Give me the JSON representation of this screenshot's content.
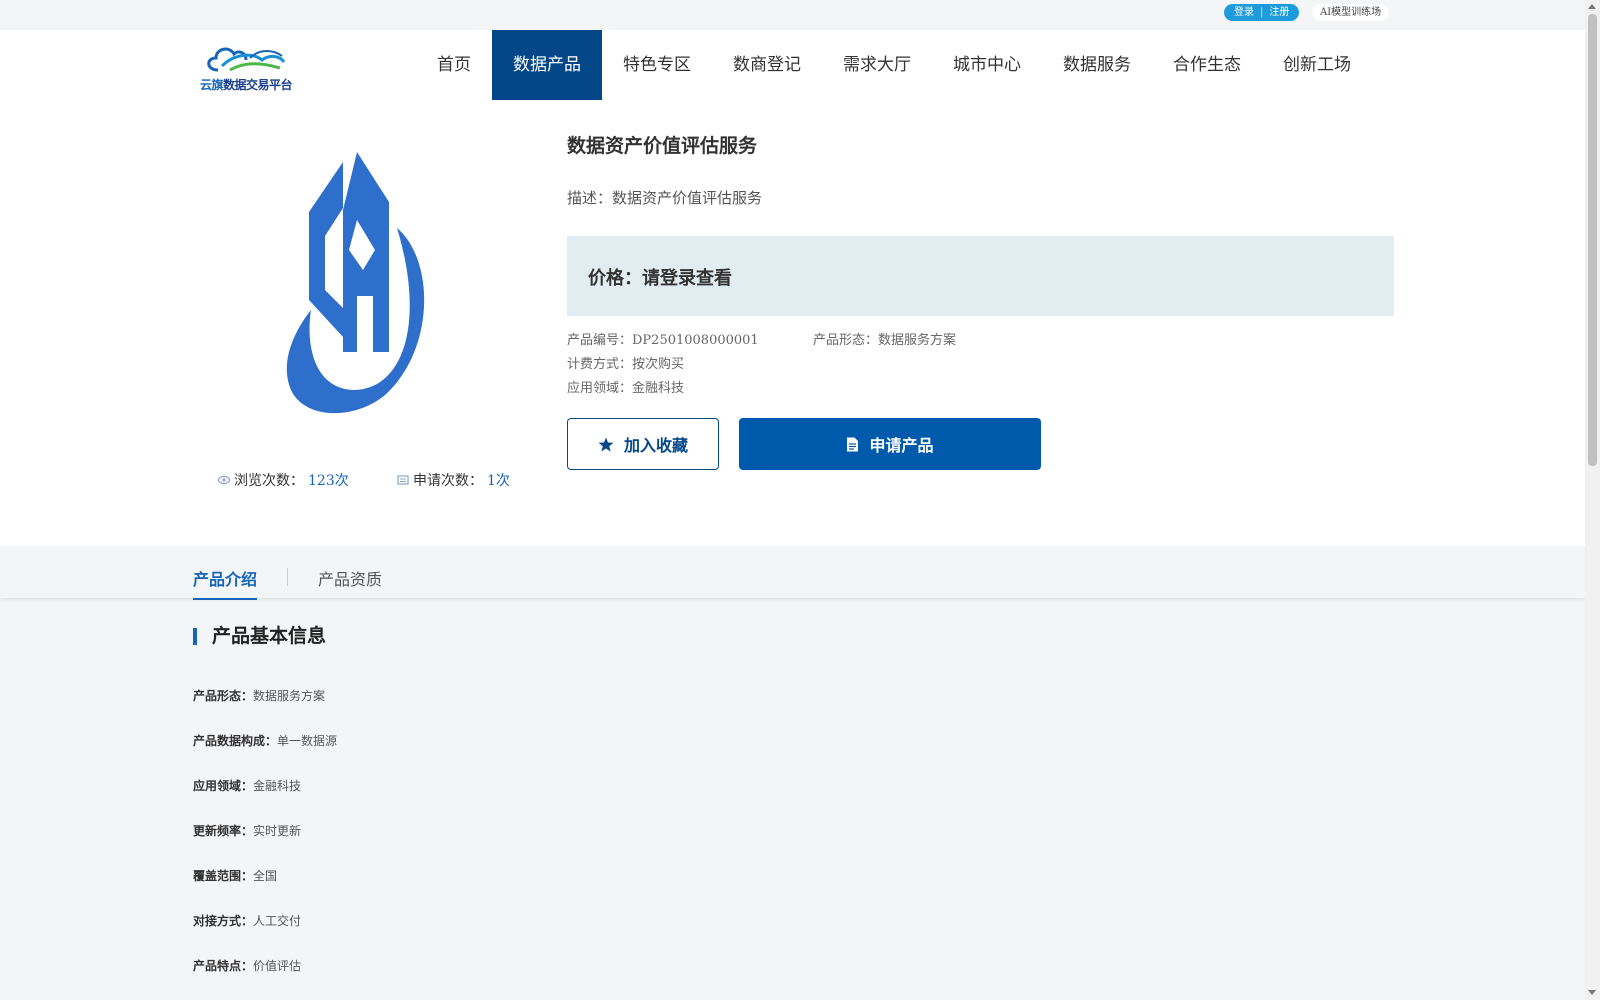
{
  "topbar": {
    "login": "登录",
    "separator": "|",
    "register": "注册",
    "ai_link": "AI模型训练场"
  },
  "header": {
    "logo_text_prefix": "云旗",
    "logo_text_suffix": "数据交易平台",
    "nav": [
      "首页",
      "数据产品",
      "特色专区",
      "数商登记",
      "需求大厅",
      "城市中心",
      "数据服务",
      "合作生态",
      "创新工场"
    ],
    "active_nav": "数据产品"
  },
  "product": {
    "title": "数据资产价值评估服务",
    "description": "描述：数据资产价值评估服务",
    "price": "价格：请登录查看",
    "code_label": "产品编号：DP2501008000001",
    "form_label": "产品形态：数据服务方案",
    "billing_label": "计费方式：按次购买",
    "domain_label": "应用领域：金融科技",
    "views_label": "浏览次数：",
    "views_value": "123次",
    "applies_label": "申请次数：",
    "applies_value": "1次",
    "favorite_button": "加入收藏",
    "apply_button": "申请产品"
  },
  "tabs": [
    "产品介绍",
    "产品资质"
  ],
  "active_tab": "产品介绍",
  "info": {
    "section_title": "产品基本信息",
    "rows": [
      {
        "label": "产品形态：",
        "value": "数据服务方案"
      },
      {
        "label": "产品数据构成：",
        "value": "单一数据源"
      },
      {
        "label": "应用领域：",
        "value": "金融科技"
      },
      {
        "label": "更新频率：",
        "value": "实时更新"
      },
      {
        "label": "覆盖范围：",
        "value": "全国"
      },
      {
        "label": "对接方式：",
        "value": "人工交付"
      },
      {
        "label": "产品特点：",
        "value": "价值评估"
      }
    ]
  },
  "colors": {
    "brand": "#034789",
    "accent": "#1565b8",
    "price_bg": "#e2edf2"
  }
}
